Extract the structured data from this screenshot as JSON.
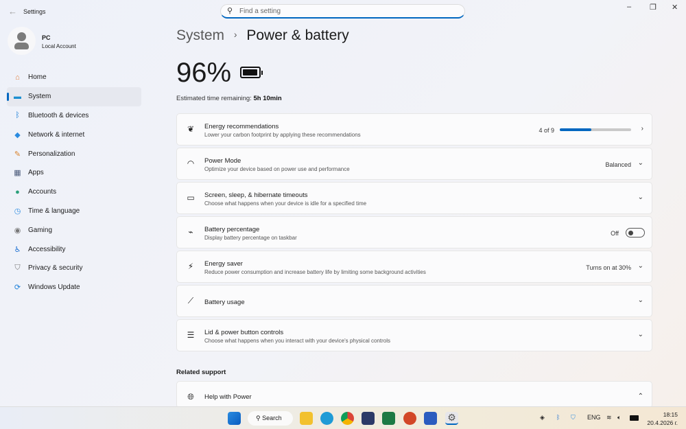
{
  "app": {
    "title": "Settings",
    "back_icon": "back-arrow-icon"
  },
  "search": {
    "placeholder": "Find a setting"
  },
  "user": {
    "name": "PC",
    "account": "Local Account"
  },
  "nav": [
    {
      "label": "Home",
      "icon": "home-icon",
      "color": "#e07b39"
    },
    {
      "label": "System",
      "icon": "system-icon",
      "color": "#1b8fd1"
    },
    {
      "label": "Bluetooth & devices",
      "icon": "bluetooth-icon",
      "color": "#1b7fd8"
    },
    {
      "label": "Network & internet",
      "icon": "wifi-icon",
      "color": "#2a8be0"
    },
    {
      "label": "Personalization",
      "icon": "brush-icon",
      "color": "#d9822b"
    },
    {
      "label": "Apps",
      "icon": "apps-icon",
      "color": "#4a5a7a"
    },
    {
      "label": "Accounts",
      "icon": "accounts-icon",
      "color": "#2aa07a"
    },
    {
      "label": "Time & language",
      "icon": "clock-globe-icon",
      "color": "#2a8be0"
    },
    {
      "label": "Gaming",
      "icon": "gamepad-icon",
      "color": "#777"
    },
    {
      "label": "Accessibility",
      "icon": "accessibility-icon",
      "color": "#1b6fd1"
    },
    {
      "label": "Privacy & security",
      "icon": "shield-icon",
      "color": "#777"
    },
    {
      "label": "Windows Update",
      "icon": "update-icon",
      "color": "#1b7fd8"
    }
  ],
  "breadcrumb": {
    "parent": "System",
    "sep": "›",
    "current": "Power & battery"
  },
  "battery": {
    "percent_text": "96%",
    "level": 0.96,
    "est_label": "Estimated time remaining:",
    "est_value": "5h 10min"
  },
  "cards": [
    {
      "title": "Energy recommendations",
      "sub": "Lower your carbon footprint by applying these recommendations",
      "value": "4 of 9",
      "progress": 0.44,
      "icon": "leaf-icon",
      "chev": "›"
    },
    {
      "title": "Power Mode",
      "sub": "Optimize your device based on power use and performance",
      "value": "Balanced",
      "icon": "gauge-icon",
      "chev": "⌄"
    },
    {
      "title": "Screen, sleep, & hibernate timeouts",
      "sub": "Choose what happens when your device is idle for a specified time",
      "icon": "screen-sleep-icon",
      "chev": "⌄"
    },
    {
      "title": "Battery percentage",
      "sub": "Display battery percentage on taskbar",
      "value": "Off",
      "icon": "battery-charging-icon"
    },
    {
      "title": "Energy saver",
      "sub": "Reduce power consumption and increase battery life by limiting some background activities",
      "value": "Turns on at 30%",
      "icon": "energy-saver-icon",
      "chev": "⌄"
    },
    {
      "title": "Battery usage",
      "icon": "chart-line-icon",
      "chev": "⌄"
    },
    {
      "title": "Lid & power button controls",
      "sub": "Choose what happens when you interact with your device's physical controls",
      "icon": "list-icon",
      "chev": "⌄"
    }
  ],
  "related": {
    "heading": "Related support",
    "help_title": "Help with Power",
    "chev": "⌃"
  },
  "taskbar": {
    "search": "Search",
    "lang": "ENG",
    "time": "18:15",
    "date": "20.4.2026 г."
  }
}
